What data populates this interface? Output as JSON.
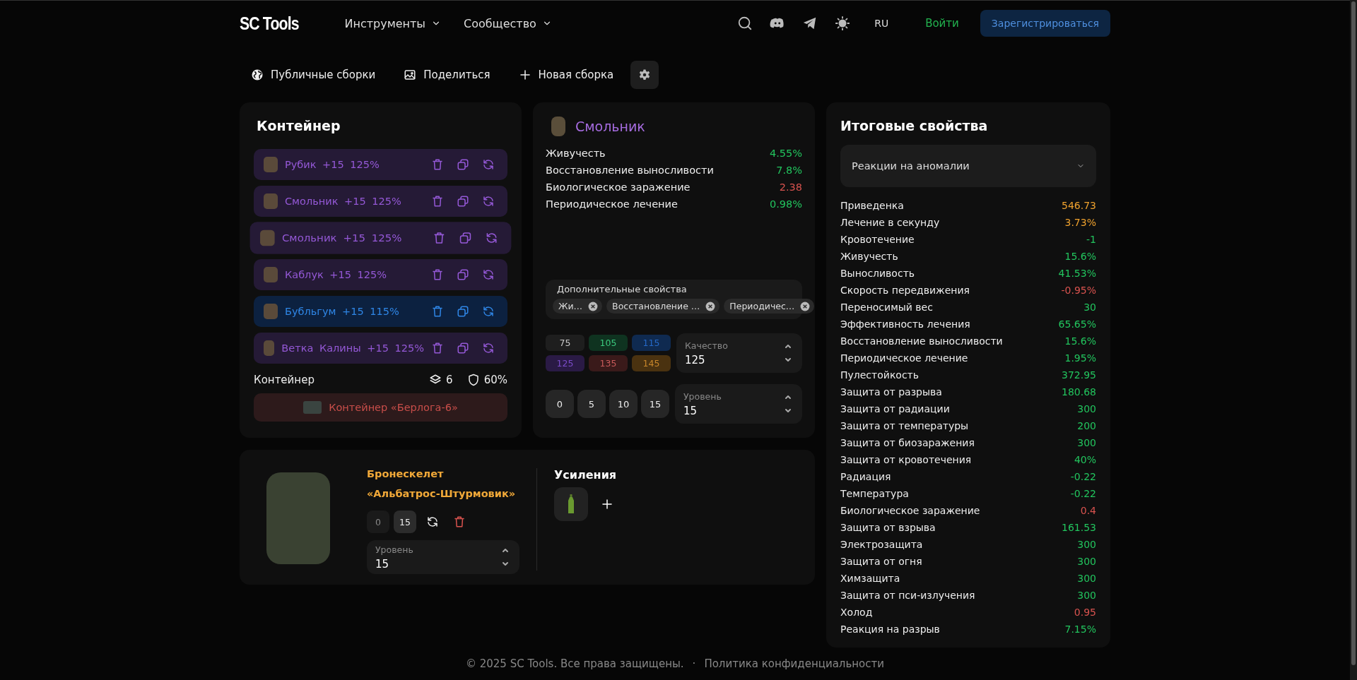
{
  "nav": {
    "logo": "SC Tools",
    "menus": [
      {
        "label": "Инструменты"
      },
      {
        "label": "Сообщество"
      }
    ],
    "language": "RU",
    "login": "Войти",
    "register": "Зарегистрироваться"
  },
  "toolbar": [
    {
      "kind": "globe",
      "label": "Публичные сборки"
    },
    {
      "kind": "image",
      "label": "Поделиться"
    },
    {
      "kind": "plus",
      "label": "Новая сборка"
    },
    {
      "kind": "gear"
    }
  ],
  "container_panel": {
    "title": "Контейнер",
    "items": [
      {
        "name": "Рубик",
        "upgrade": "+15",
        "quality": "125%",
        "color": "#9458d6",
        "selected": false
      },
      {
        "name": "Смольник",
        "upgrade": "+15",
        "quality": "125%",
        "color": "#9458d6",
        "selected": false
      },
      {
        "name": "Смольник",
        "upgrade": "+15",
        "quality": "125%",
        "color": "#9458d6",
        "selected": true
      },
      {
        "name": "Каблук",
        "upgrade": "+15",
        "quality": "125%",
        "color": "#9458d6",
        "selected": false
      },
      {
        "name": "Бубльгум",
        "upgrade": "+15",
        "quality": "115%",
        "color": "#2f86e6",
        "selected": false
      },
      {
        "name": "Ветка Калины",
        "upgrade": "+15",
        "quality": "125%",
        "color": "#9458d6",
        "selected": false
      }
    ],
    "footer_label": "Контейнер",
    "slots": "6",
    "protection": "60%",
    "container_button": "Контейнер «Берлога-6»"
  },
  "artifact_panel": {
    "title": "Смольник",
    "stats": [
      {
        "name": "Живучесть",
        "value": "4.55%",
        "color": "#22c55e"
      },
      {
        "name": "Восстановление выносливости",
        "value": "7.8%",
        "color": "#22c55e"
      },
      {
        "name": "Биологическое заражение",
        "value": "2.38",
        "color": "#d9534f"
      },
      {
        "name": "Периодическое лечение",
        "value": "0.98%",
        "color": "#22c55e"
      }
    ],
    "extra_label": "Дополнительные свойства",
    "extra_tags": [
      "Жи…",
      "Восстановление …",
      "Периодичес…"
    ],
    "quality_options": [
      {
        "label": "75",
        "color": "#1e1e1e"
      },
      {
        "label": "105",
        "color": "#0f3320"
      },
      {
        "label": "115",
        "color": "#0f2a50"
      },
      {
        "label": "125",
        "color": "#2a1a45"
      },
      {
        "label": "135",
        "color": "#3a1a1a"
      },
      {
        "label": "145",
        "color": "#4a3210"
      }
    ],
    "quality_field": {
      "label": "Качество",
      "value": "125"
    },
    "level_options": [
      {
        "label": "0"
      },
      {
        "label": "5"
      },
      {
        "label": "10"
      },
      {
        "label": "15"
      }
    ],
    "level_field": {
      "label": "Уровень",
      "value": "15"
    }
  },
  "armor_panel": {
    "title": "Бронескелет «Альбатрос-Штурмовик»",
    "levels": [
      {
        "label": "0",
        "selected": false
      },
      {
        "label": "15",
        "selected": true
      }
    ],
    "level_field": {
      "label": "Уровень",
      "value": "15"
    },
    "boosts_title": "Усиления"
  },
  "totals_panel": {
    "title": "Итоговые свойства",
    "dropdown": "Реакции на аномалии",
    "stats": [
      {
        "name": "Приведенка",
        "value": "546.73",
        "color": "#f0a22e"
      },
      {
        "name": "Лечение в секунду",
        "value": "3.73%",
        "color": "#f0a22e"
      },
      {
        "name": "Кровотечение",
        "value": "-1",
        "color": "#22c55e"
      },
      {
        "name": "Живучесть",
        "value": "15.6%",
        "color": "#22c55e"
      },
      {
        "name": "Выносливость",
        "value": "41.53%",
        "color": "#22c55e"
      },
      {
        "name": "Скорость передвижения",
        "value": "-0.95%",
        "color": "#d9534f"
      },
      {
        "name": "Переносимый вес",
        "value": "30",
        "color": "#22c55e"
      },
      {
        "name": "Эффективность лечения",
        "value": "65.65%",
        "color": "#22c55e"
      },
      {
        "name": "Восстановление выносливости",
        "value": "15.6%",
        "color": "#22c55e"
      },
      {
        "name": "Периодическое лечение",
        "value": "1.95%",
        "color": "#22c55e"
      },
      {
        "name": "Пулестойкость",
        "value": "372.95",
        "color": "#22c55e"
      },
      {
        "name": "Защита от разрыва",
        "value": "180.68",
        "color": "#22c55e"
      },
      {
        "name": "Защита от радиации",
        "value": "300",
        "color": "#22c55e"
      },
      {
        "name": "Защита от температуры",
        "value": "200",
        "color": "#22c55e"
      },
      {
        "name": "Защита от биозаражения",
        "value": "300",
        "color": "#22c55e"
      },
      {
        "name": "Защита от кровотечения",
        "value": "40%",
        "color": "#22c55e"
      },
      {
        "name": "Радиация",
        "value": "-0.22",
        "color": "#22c55e"
      },
      {
        "name": "Температура",
        "value": "-0.22",
        "color": "#22c55e"
      },
      {
        "name": "Биологическое заражение",
        "value": "0.4",
        "color": "#d9534f"
      },
      {
        "name": "Защита от взрыва",
        "value": "161.53",
        "color": "#22c55e"
      },
      {
        "name": "Электрозащита",
        "value": "300",
        "color": "#22c55e"
      },
      {
        "name": "Защита от огня",
        "value": "300",
        "color": "#22c55e"
      },
      {
        "name": "Химзащита",
        "value": "300",
        "color": "#22c55e"
      },
      {
        "name": "Защита от пси-излучения",
        "value": "300",
        "color": "#22c55e"
      },
      {
        "name": "Холод",
        "value": "0.95",
        "color": "#d9534f"
      },
      {
        "name": "Реакция на разрыв",
        "value": "7.15%",
        "color": "#22c55e"
      }
    ]
  },
  "footer": {
    "copyright": "© 2025 SC Tools. Все права защищены.",
    "separator": "·",
    "privacy": "Политика конфиденциальности"
  }
}
